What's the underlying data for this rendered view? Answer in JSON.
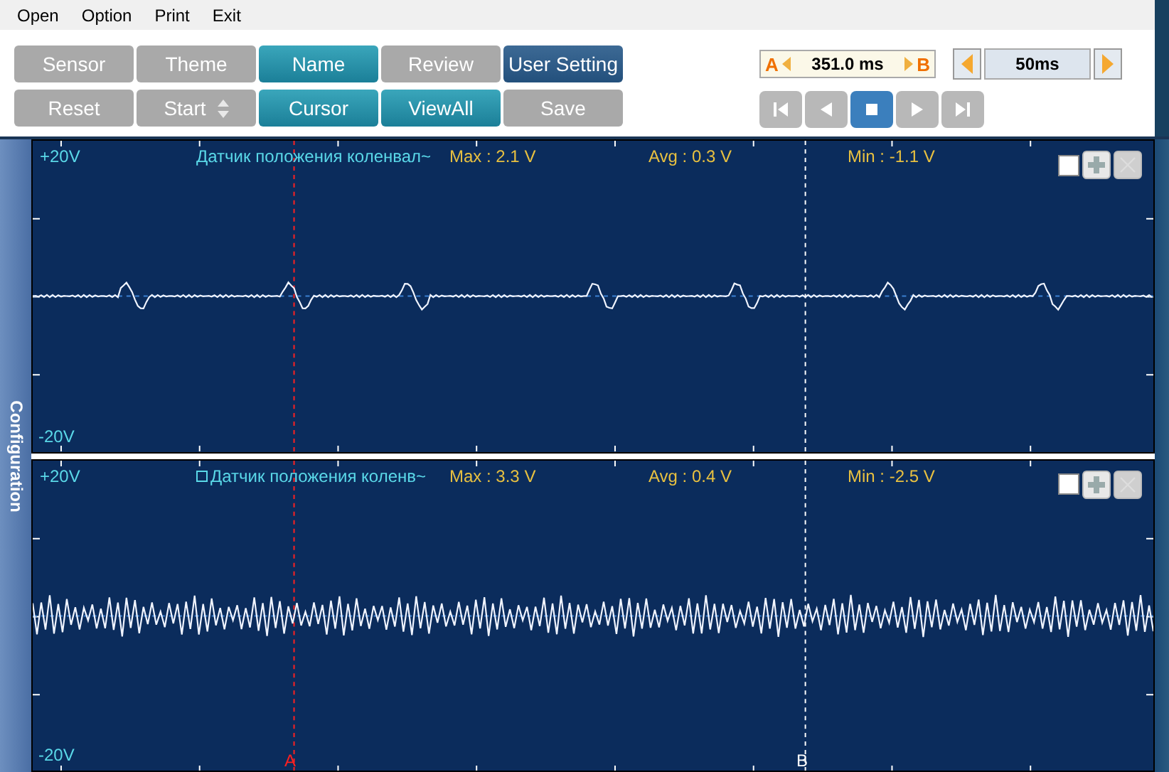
{
  "menu": [
    "Open",
    "Option",
    "Print",
    "Exit"
  ],
  "buttons": [
    [
      {
        "label": "Sensor",
        "kind": "disabled"
      },
      {
        "label": "Theme",
        "kind": "disabled"
      },
      {
        "label": "Name",
        "kind": "teal"
      },
      {
        "label": "Review",
        "kind": "disabled"
      },
      {
        "label": "User Setting",
        "kind": "dark"
      }
    ],
    [
      {
        "label": "Reset",
        "kind": "disabled"
      },
      {
        "label": "Start",
        "kind": "spinner"
      },
      {
        "label": "Cursor",
        "kind": "teal"
      },
      {
        "label": "ViewAll",
        "kind": "teal"
      },
      {
        "label": "Save",
        "kind": "disabled"
      }
    ]
  ],
  "cursor_readout": {
    "a": "A",
    "value": "351.0 ms",
    "b": "B"
  },
  "timebase": {
    "value": "50ms"
  },
  "transport": [
    {
      "kind": "first",
      "selected": false
    },
    {
      "kind": "prev",
      "selected": false
    },
    {
      "kind": "stop",
      "selected": true
    },
    {
      "kind": "next",
      "selected": false
    },
    {
      "kind": "last",
      "selected": false
    }
  ],
  "sidebar": {
    "label": "Configuration"
  },
  "channels": [
    {
      "top": "+20V",
      "bottom": "-20V",
      "name": "Датчик положения коленвал~",
      "max": "Max : 2.1 V",
      "avg": "Avg : 0.3 V",
      "min": "Min : -1.1 V",
      "marker": false,
      "checked": false
    },
    {
      "top": "+20V",
      "bottom": "-20V",
      "name": "Датчик положения коленв~",
      "max": "Max : 3.3 V",
      "avg": "Avg : 0.4 V",
      "min": "Min : -2.5 V",
      "marker": true,
      "checked": false
    }
  ],
  "cursors": [
    {
      "label": "A",
      "color": "#ff2020"
    },
    {
      "label": "B",
      "color": "#ffffff"
    }
  ]
}
